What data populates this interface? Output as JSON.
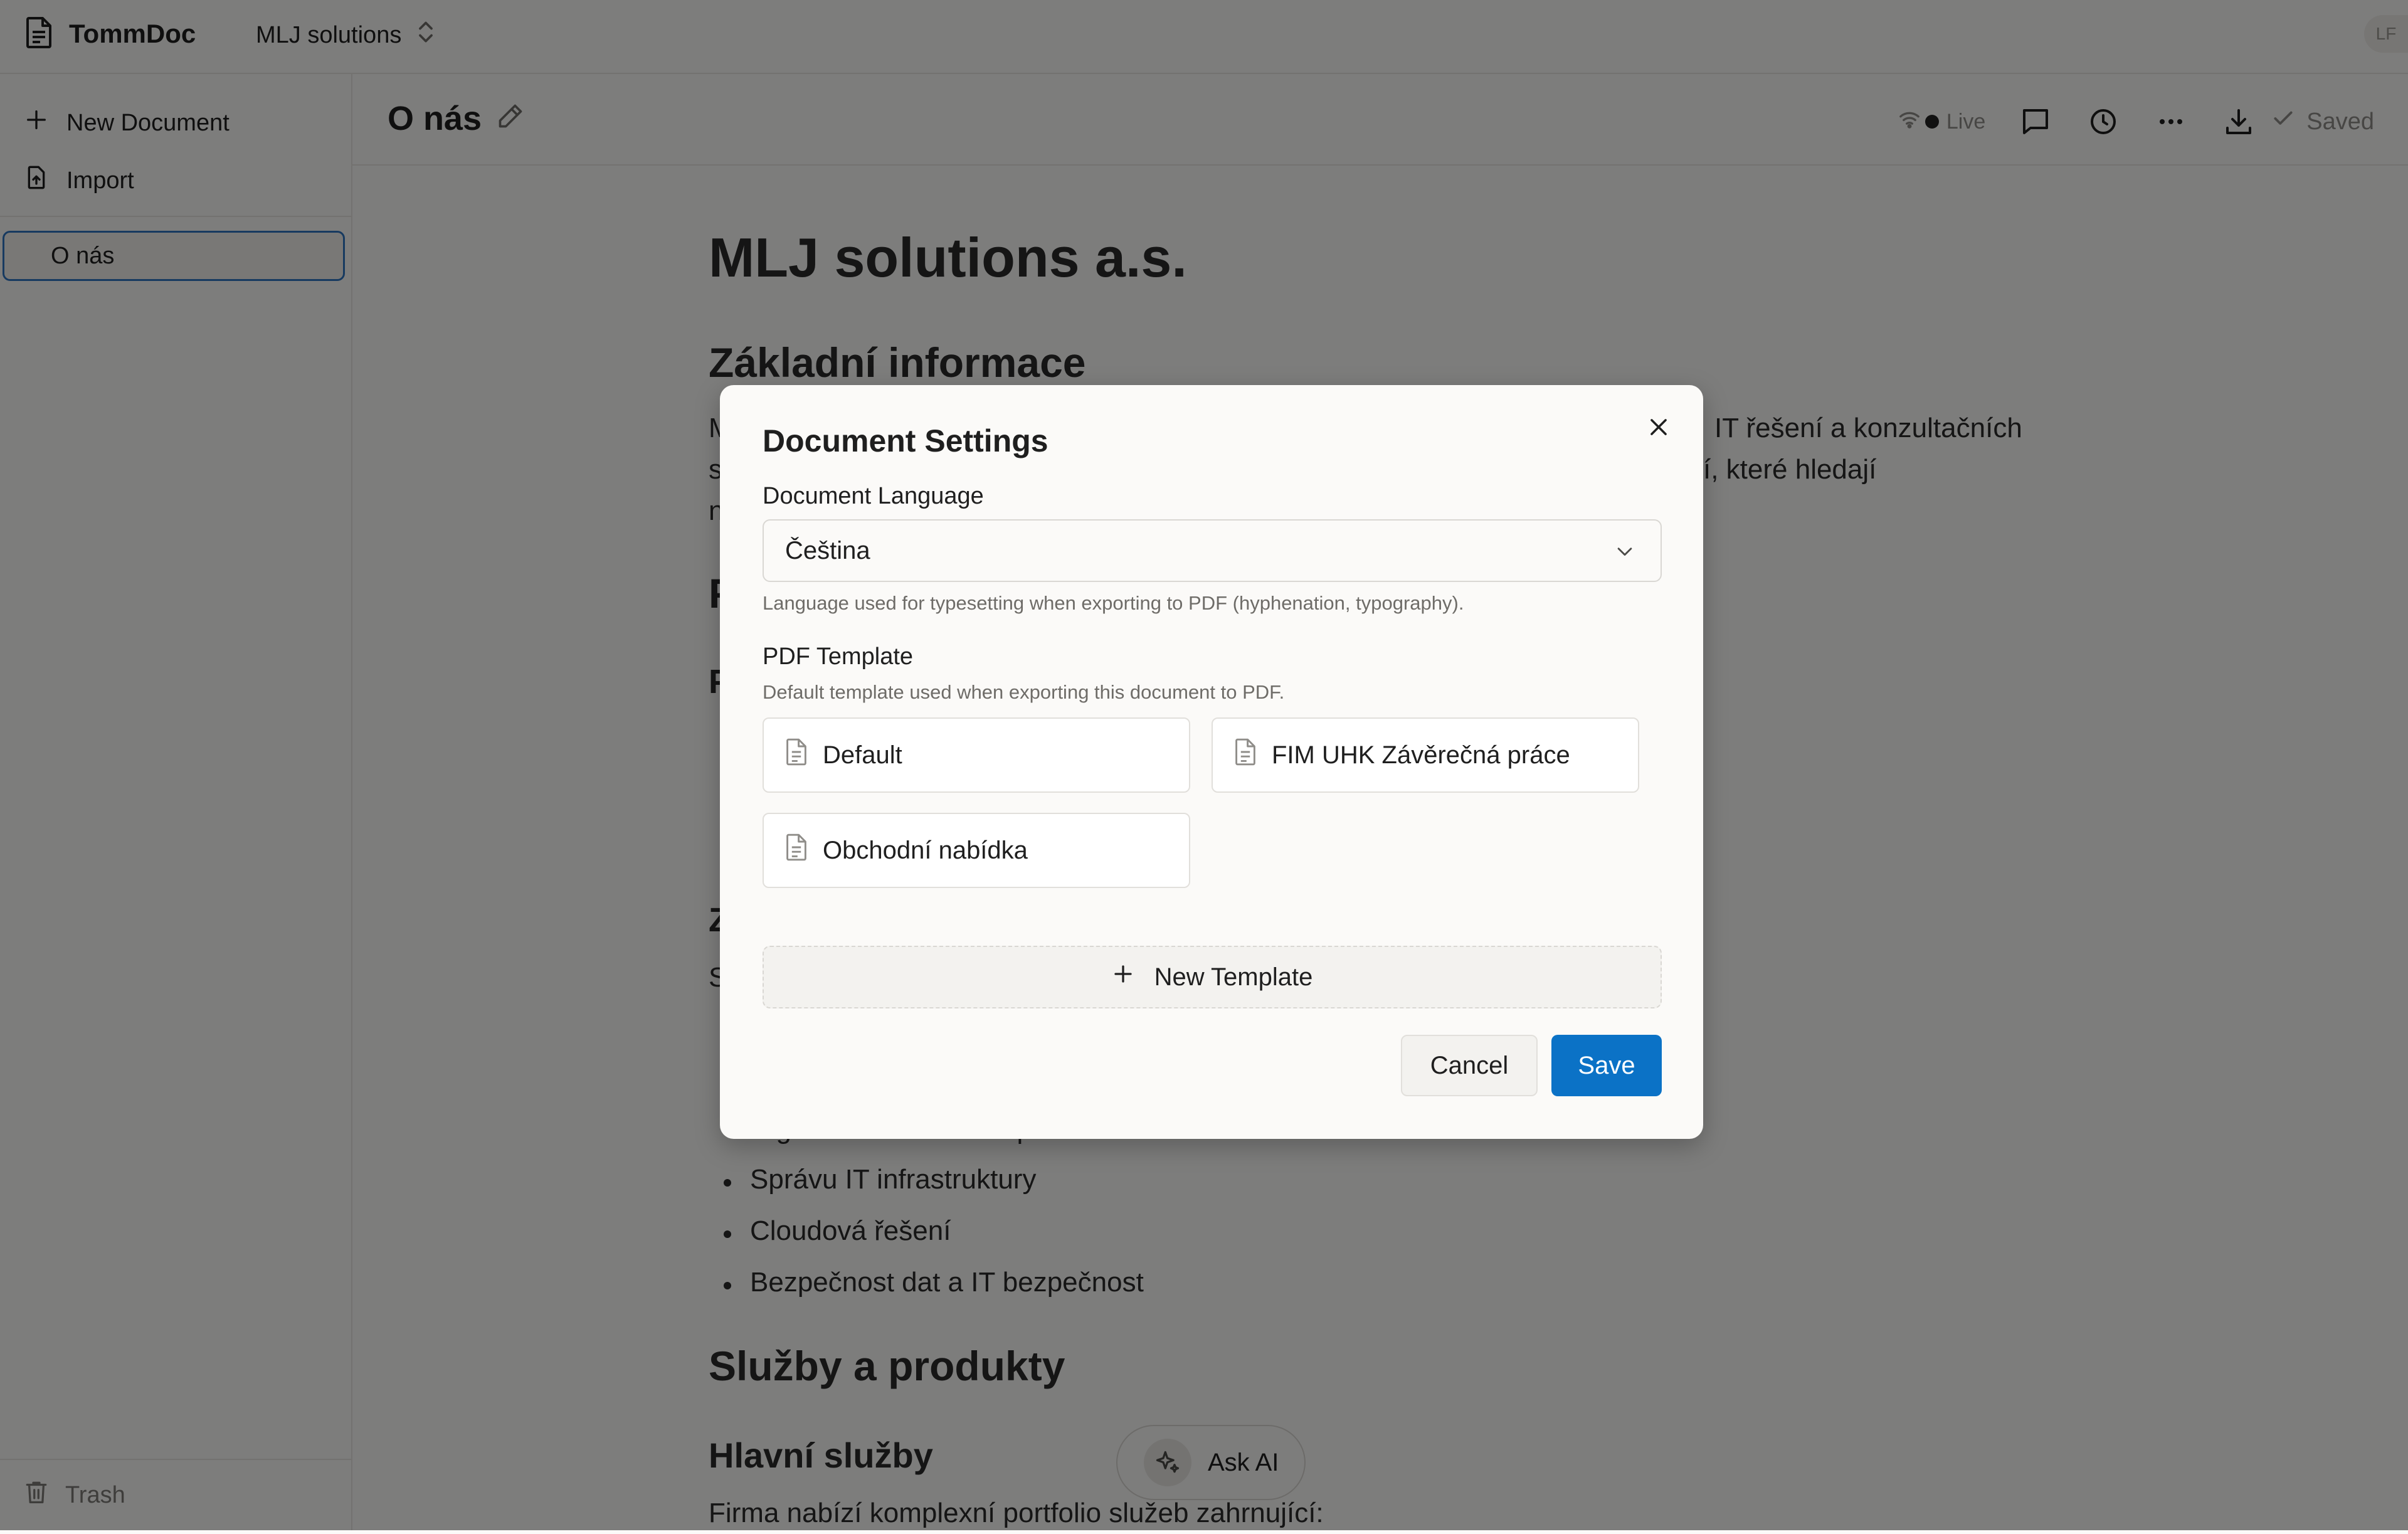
{
  "app": {
    "name": "TommDoc",
    "workspace": "MLJ solutions",
    "user_initials": "LF"
  },
  "sidebar": {
    "new_document": "New Document",
    "import": "Import",
    "documents": [
      {
        "title": "O nás",
        "active": true
      }
    ],
    "trash": "Trash"
  },
  "doc_header": {
    "title": "O nás",
    "status_live": "Live",
    "status_saved": "Saved"
  },
  "document": {
    "h1": "MLJ solutions a.s.",
    "section1_heading": "Základní informace",
    "para1_line1_start": "M",
    "para1_line1_end": "IT řešení a konzultačních",
    "para1_line2_start": "s",
    "para1_line2_end": "í, které hledají",
    "para1_line3_start": "n",
    "hidden_heading_1": "P",
    "hidden_heading_2": "P",
    "hidden_heading_3": "Z",
    "hidden_para": "S",
    "bullets": [
      "Digitální transformaci podniku",
      "Správu IT infrastruktury",
      "Cloudová řešení",
      "Bezpečnost dat a IT bezpečnost"
    ],
    "section_services": "Služby a produkty",
    "subsection_main": "Hlavní služby",
    "services_intro": "Firma nabízí komplexní portfolio služeb zahrnující:"
  },
  "ask_ai": {
    "label": "Ask AI"
  },
  "modal": {
    "title": "Document Settings",
    "language_label": "Document Language",
    "language_value": "Čeština",
    "language_hint": "Language used for typesetting when exporting to PDF (hyphenation, typography).",
    "template_label": "PDF Template",
    "template_hint": "Default template used when exporting this document to PDF.",
    "templates": [
      {
        "name": "Default"
      },
      {
        "name": "FIM UHK Závěrečná práce"
      },
      {
        "name": "Obchodní nabídka"
      }
    ],
    "new_template": "New Template",
    "cancel": "Cancel",
    "save": "Save"
  },
  "colors": {
    "accent": "#0b72c6",
    "active_border": "#2f74c0",
    "background": "#fbfaf8"
  }
}
